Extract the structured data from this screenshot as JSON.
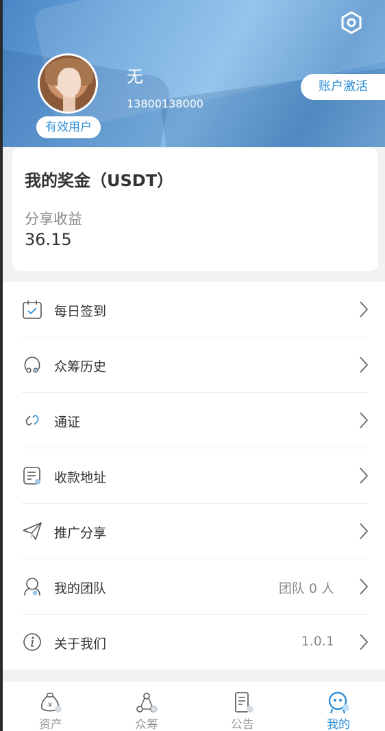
{
  "header": {
    "user_name": "无",
    "user_phone": "13800138000",
    "user_status_badge": "有效用户",
    "activate_button": "账户激活"
  },
  "bonus": {
    "title": "我的奖金（USDT）",
    "subtitle": "分享收益",
    "value": "36.15"
  },
  "menu": {
    "items": [
      {
        "label": "每日签到",
        "value": "",
        "icon": "calendar-check-icon"
      },
      {
        "label": "众筹历史",
        "value": "",
        "icon": "crowdfund-history-icon"
      },
      {
        "label": "通证",
        "value": "",
        "icon": "token-link-icon"
      },
      {
        "label": "收款地址",
        "value": "",
        "icon": "address-doc-icon"
      },
      {
        "label": "推广分享",
        "value": "",
        "icon": "paper-plane-icon"
      },
      {
        "label": "我的团队",
        "value": "团队 0 人",
        "icon": "team-icon"
      },
      {
        "label": "关于我们",
        "value": "1.0.1",
        "icon": "info-icon"
      }
    ]
  },
  "tabbar": {
    "tabs": [
      {
        "label": "资产",
        "icon": "money-bag-icon",
        "active": false
      },
      {
        "label": "众筹",
        "icon": "crowdfund-icon",
        "active": false
      },
      {
        "label": "公告",
        "icon": "notice-icon",
        "active": false
      },
      {
        "label": "我的",
        "icon": "profile-icon",
        "active": true
      }
    ]
  },
  "colors": {
    "accent": "#2f8fd7",
    "header_blue": "#5c97cf"
  }
}
